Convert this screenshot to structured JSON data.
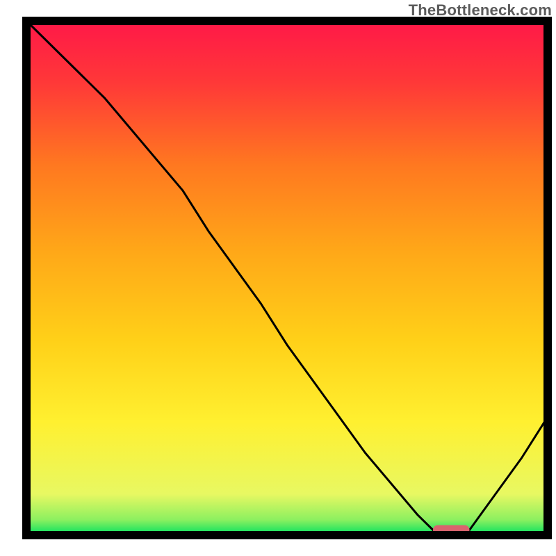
{
  "watermark": "TheBottleneck.com",
  "chart_data": {
    "type": "line",
    "title": "",
    "xlabel": "",
    "ylabel": "",
    "xlim": [
      0,
      100
    ],
    "ylim": [
      0,
      100
    ],
    "x": [
      0,
      5,
      10,
      15,
      20,
      25,
      30,
      35,
      40,
      45,
      50,
      55,
      60,
      65,
      70,
      75,
      78,
      80,
      82,
      85,
      90,
      95,
      100
    ],
    "values": [
      100,
      95,
      90,
      85,
      79,
      73,
      67,
      59,
      52,
      45,
      37,
      30,
      23,
      16,
      10,
      4,
      1,
      0,
      0,
      1,
      8,
      15,
      23
    ],
    "optimal_segment": {
      "x_start": 78,
      "x_end": 85,
      "y": 1
    },
    "gradient_stops": [
      {
        "pct": 0,
        "color": "#00E060"
      },
      {
        "pct": 3,
        "color": "#8CF060"
      },
      {
        "pct": 8,
        "color": "#E8F862"
      },
      {
        "pct": 22,
        "color": "#FFF030"
      },
      {
        "pct": 38,
        "color": "#FFD018"
      },
      {
        "pct": 55,
        "color": "#FFA818"
      },
      {
        "pct": 72,
        "color": "#FF7820"
      },
      {
        "pct": 88,
        "color": "#FF3838"
      },
      {
        "pct": 100,
        "color": "#FF1848"
      }
    ],
    "frame_color": "#000000",
    "line_color": "#000000",
    "marker_color": "#D9646E"
  }
}
